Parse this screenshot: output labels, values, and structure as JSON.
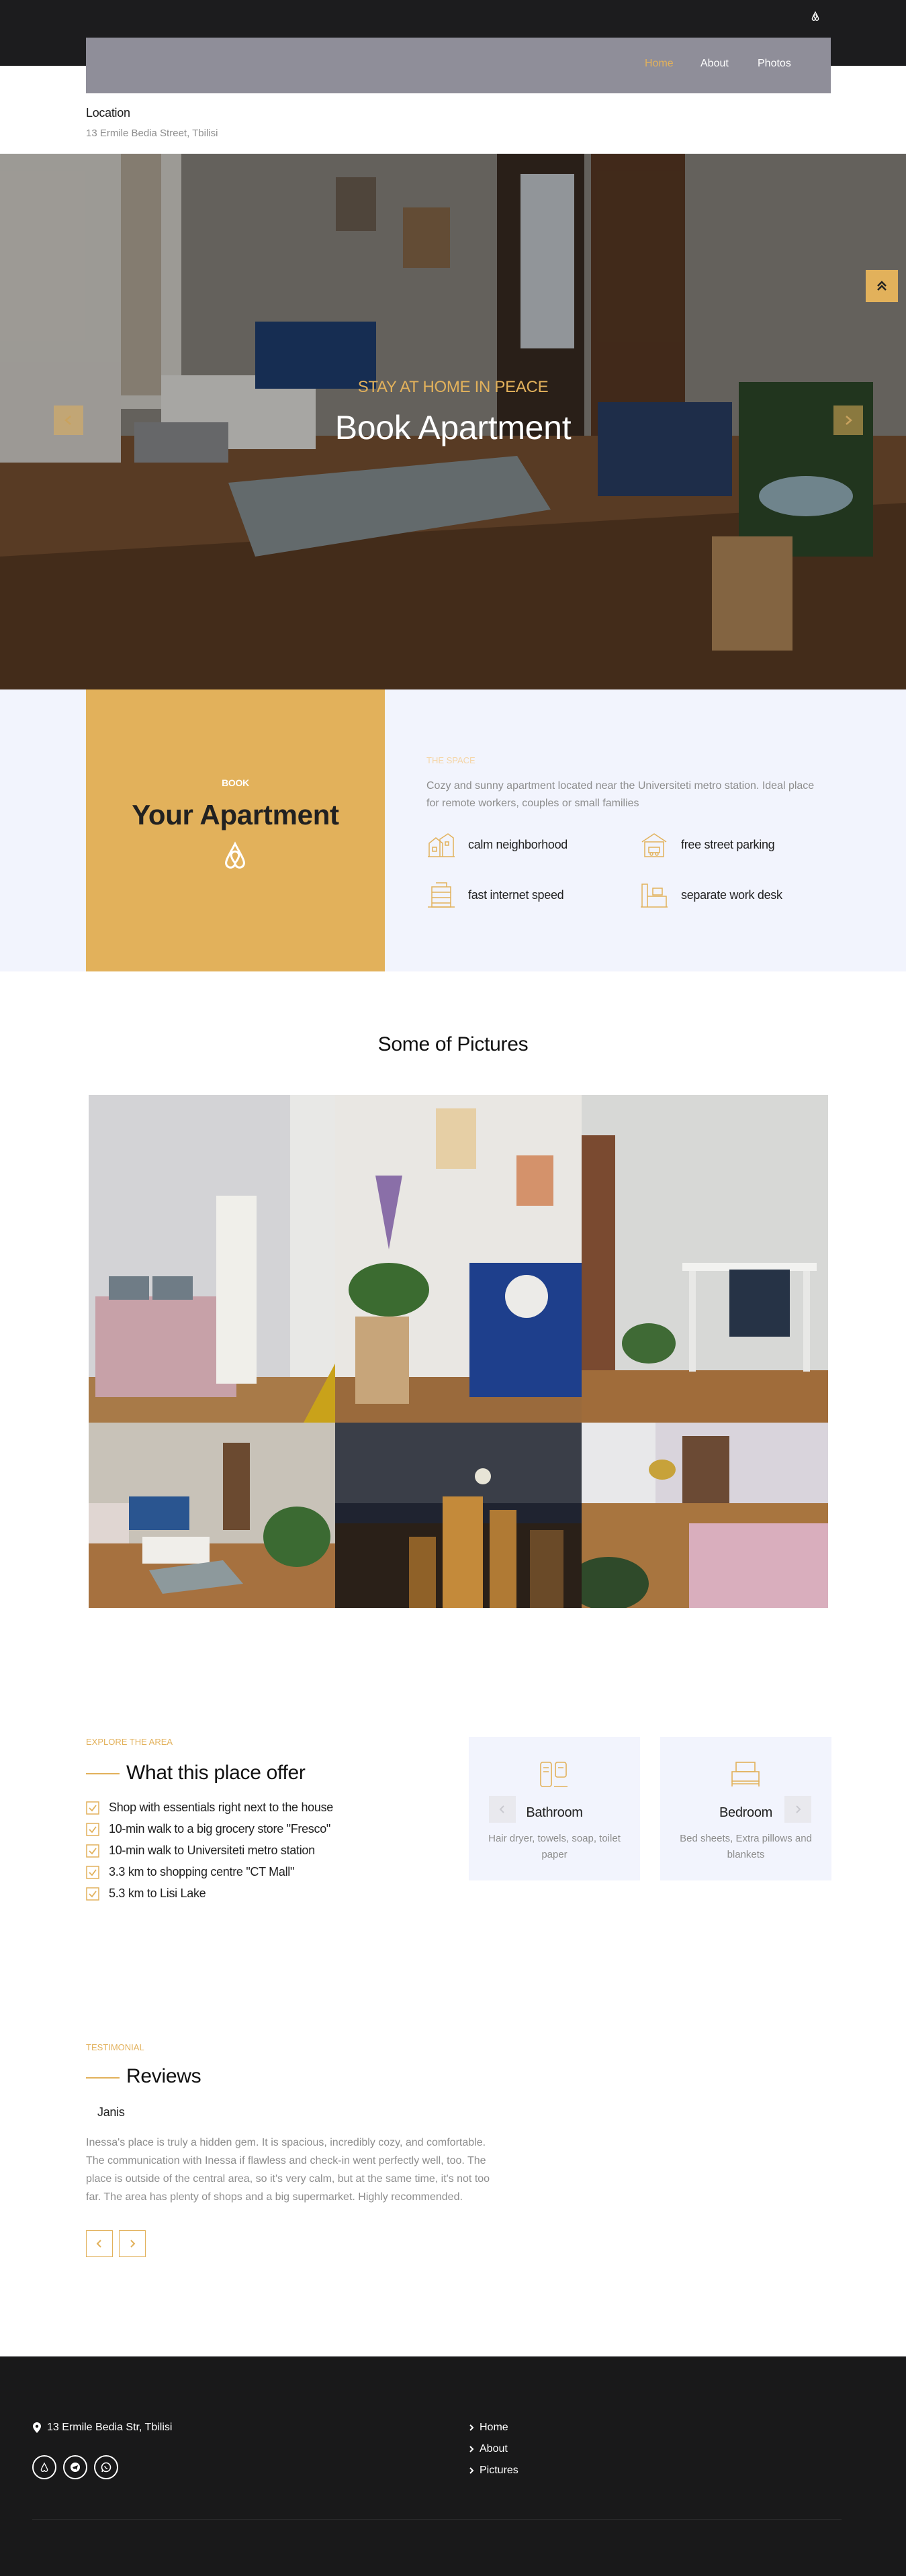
{
  "nav": {
    "links": [
      {
        "label": "Home"
      },
      {
        "label": "About"
      },
      {
        "label": "Photos"
      }
    ],
    "active": "Home",
    "logo_icon": "airbnb-icon"
  },
  "location": {
    "label": "Location",
    "value": "13 Ermile Bedia Street, Tbilisi"
  },
  "hero": {
    "subtitle": "STAY AT HOME IN PEACE",
    "title": "Book Apartment",
    "prev_icon": "chevron-left-icon",
    "next_icon": "chevron-right-icon",
    "scroll_top_icon": "double-chevron-up-icon"
  },
  "booking": {
    "small_label": "BOOK",
    "big_label": "Your Apartment",
    "tag": "THE SPACE",
    "description": "Cozy and sunny apartment located near the Universiteti metro station. Ideal place for remote workers, couples or small families",
    "features": [
      {
        "label": "calm neighborhood",
        "icon": "neighborhood-icon"
      },
      {
        "label": "free street parking",
        "icon": "parking-icon"
      },
      {
        "label": "fast internet speed",
        "icon": "building-icon"
      },
      {
        "label": "separate work desk",
        "icon": "desk-icon"
      }
    ]
  },
  "pictures": {
    "title": "Some of Pictures"
  },
  "area": {
    "tag": "EXPLORE THE AREA",
    "title": "What this place offer",
    "items": [
      "Shop with essentials right next to the house",
      "10-min walk to a big grocery store \"Fresco\"",
      "10-min walk to Universiteti metro station",
      "3.3 km to shopping centre \"CT Mall\"",
      "5.3 km to Lisi Lake"
    ],
    "amenities": [
      {
        "title": "Bathroom",
        "description": "Hair dryer, towels, soap, toilet paper",
        "icon": "bathroom-icon"
      },
      {
        "title": "Bedroom",
        "description": "Bed sheets, Extra pillows and blankets",
        "icon": "bed-icon"
      }
    ]
  },
  "reviews": {
    "tag": "TESTIMONIAL",
    "title": "Reviews",
    "reviewer": "Janis",
    "text": "Inessa's place is truly a hidden gem. It is spacious, incredibly cozy, and comfortable. The communication with Inessa if flawless and check-in went perfectly well, too. The place is outside of the central area, so it's very calm, but at the same time, it's not too far. The area has plenty of shops and a big supermarket. Highly recommended."
  },
  "footer": {
    "address": "13 Ermile Bedia Str, Tbilisi",
    "links": [
      "Home",
      "About",
      "Pictures"
    ],
    "socials": [
      "airbnb-icon",
      "telegram-icon",
      "whatsapp-icon"
    ]
  },
  "colors": {
    "accent": "#e2b15b",
    "dark": "#1c1c1e",
    "light_band": "#f2f4fd",
    "muted_text": "#8d8d8d"
  }
}
